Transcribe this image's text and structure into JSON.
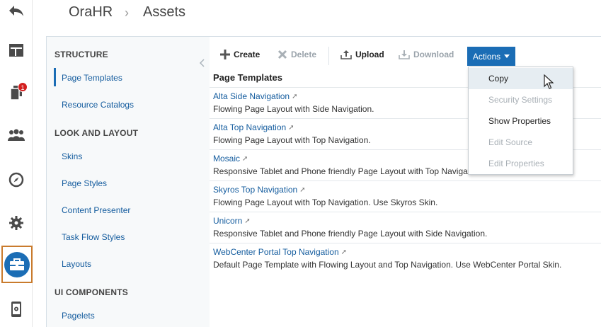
{
  "header": {
    "app": "OraHR",
    "separator": "›",
    "page": "Assets"
  },
  "rail": {
    "items": [
      {
        "icon": "back-arrow-icon"
      },
      {
        "icon": "layout-icon"
      },
      {
        "icon": "pages-icon",
        "badge": "1"
      },
      {
        "icon": "people-icon"
      },
      {
        "icon": "compass-icon"
      },
      {
        "icon": "gear-icon"
      },
      {
        "icon": "toolbox-icon",
        "selected": true
      },
      {
        "icon": "device-settings-icon"
      }
    ],
    "accent": "#1b6db5",
    "selected_border": "#c97b2d"
  },
  "nav": {
    "sections": [
      {
        "title": "STRUCTURE",
        "items": [
          "Page Templates",
          "Resource Catalogs"
        ]
      },
      {
        "title": "LOOK AND LAYOUT",
        "items": [
          "Skins",
          "Page Styles",
          "Content Presenter",
          "Task Flow Styles",
          "Layouts"
        ]
      },
      {
        "title": "UI COMPONENTS",
        "items": [
          "Pagelets"
        ]
      }
    ],
    "selected": "Page Templates"
  },
  "toolbar": {
    "create": "Create",
    "delete": "Delete",
    "upload": "Upload",
    "download": "Download",
    "actions": "Actions"
  },
  "list": {
    "title": "Page Templates",
    "rows": [
      {
        "name": "Alta Side Navigation",
        "desc": "Flowing Page Layout with Side Navigation."
      },
      {
        "name": "Alta Top Navigation",
        "desc": "Flowing Page Layout with Top Navigation."
      },
      {
        "name": "Mosaic",
        "desc": "Responsive Tablet and Phone friendly Page Layout with Top Navigation."
      },
      {
        "name": "Skyros Top Navigation",
        "desc": "Flowing Page Layout with Top Navigation. Use Skyros Skin."
      },
      {
        "name": "Unicorn",
        "desc": "Responsive Tablet and Phone friendly Page Layout with Side Navigation."
      },
      {
        "name": "WebCenter Portal Top Navigation",
        "desc": "Default Page Template with Flowing Layout and Top Navigation. Use WebCenter Portal Skin."
      }
    ]
  },
  "menu": {
    "items": [
      {
        "label": "Copy",
        "enabled": true,
        "hover": true
      },
      {
        "label": "Security Settings",
        "enabled": false
      },
      {
        "label": "Show Properties",
        "enabled": true
      },
      {
        "label": "Edit Source",
        "enabled": false
      },
      {
        "label": "Edit Properties",
        "enabled": false
      }
    ]
  }
}
